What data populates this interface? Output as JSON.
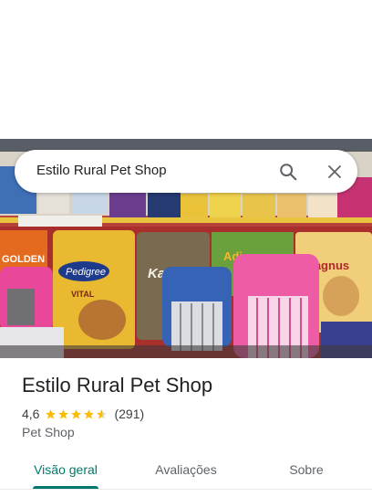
{
  "search": {
    "query": "Estilo Rural Pet Shop",
    "search_icon": "search-icon",
    "close_icon": "close-icon"
  },
  "place": {
    "name": "Estilo Rural Pet Shop",
    "rating": "4,6",
    "rating_stars": 4.6,
    "review_count": "(291)",
    "category": "Pet Shop"
  },
  "photo": {
    "labels": [
      "Pedigree",
      "VITAL",
      "Kanina",
      "Adimax",
      "Magnus",
      "GOLDEN"
    ]
  },
  "tabs": [
    {
      "label": "Visão geral",
      "active": true
    },
    {
      "label": "Avaliações",
      "active": false
    },
    {
      "label": "Sobre",
      "active": false
    }
  ],
  "colors": {
    "accent": "#00796b",
    "star": "#fbbc04"
  }
}
